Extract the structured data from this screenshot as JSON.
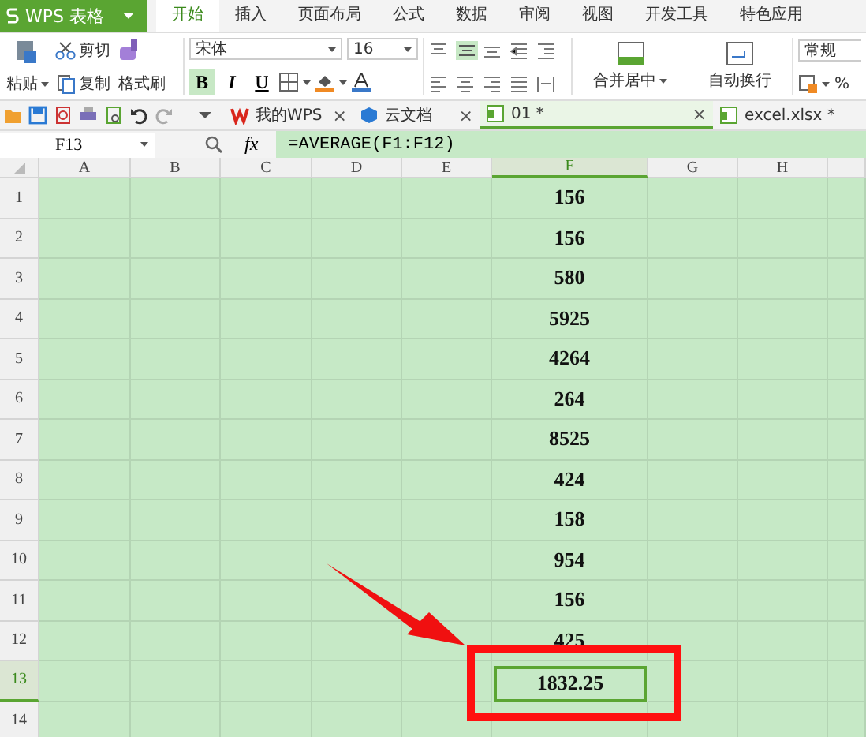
{
  "app": {
    "label": "WPS 表格"
  },
  "ribbon_tabs": [
    {
      "label": "开始",
      "selected": true
    },
    {
      "label": "插入",
      "selected": false
    },
    {
      "label": "页面布局",
      "selected": false
    },
    {
      "label": "公式",
      "selected": false
    },
    {
      "label": "数据",
      "selected": false
    },
    {
      "label": "审阅",
      "selected": false
    },
    {
      "label": "视图",
      "selected": false
    },
    {
      "label": "开发工具",
      "selected": false
    },
    {
      "label": "特色应用",
      "selected": false
    }
  ],
  "ribbon": {
    "paste": "粘贴",
    "cut": "剪切",
    "copy": "复制",
    "format_painter": "格式刷",
    "font_name": "宋体",
    "font_size": "16",
    "styles": [
      {
        "label": "B",
        "on": true
      },
      {
        "label": "I",
        "on": false
      },
      {
        "label": "U",
        "on": false
      }
    ],
    "merge": "合并居中",
    "wrap": "自动换行",
    "number_format": "常规",
    "percent": "%"
  },
  "doc_tabs": [
    {
      "label": "我的WPS",
      "selected": false,
      "close": "×"
    },
    {
      "label": "云文档",
      "selected": false,
      "close": "×"
    },
    {
      "label": "01 *",
      "selected": true,
      "close": "×"
    },
    {
      "label": "excel.xlsx *",
      "selected": false
    }
  ],
  "formula_bar": {
    "name_box": "F13",
    "fx": "fx",
    "formula": "=AVERAGE(F1:F12)"
  },
  "columns": [
    {
      "label": "A",
      "selected": false
    },
    {
      "label": "B",
      "selected": false
    },
    {
      "label": "C",
      "selected": false
    },
    {
      "label": "D",
      "selected": false
    },
    {
      "label": "E",
      "selected": false
    },
    {
      "label": "F",
      "selected": true
    },
    {
      "label": "G",
      "selected": false
    },
    {
      "label": "H",
      "selected": false
    }
  ],
  "rows": [
    {
      "number": "1",
      "f": "156",
      "selected": false
    },
    {
      "number": "2",
      "f": "156",
      "selected": false
    },
    {
      "number": "3",
      "f": "580",
      "selected": false
    },
    {
      "number": "4",
      "f": "5925",
      "selected": false
    },
    {
      "number": "5",
      "f": "4264",
      "selected": false
    },
    {
      "number": "6",
      "f": "264",
      "selected": false
    },
    {
      "number": "7",
      "f": "8525",
      "selected": false
    },
    {
      "number": "8",
      "f": "424",
      "selected": false
    },
    {
      "number": "9",
      "f": "158",
      "selected": false
    },
    {
      "number": "10",
      "f": "954",
      "selected": false
    },
    {
      "number": "11",
      "f": "156",
      "selected": false
    },
    {
      "number": "12",
      "f": "425",
      "selected": false
    },
    {
      "number": "13",
      "f": "1832.25",
      "selected": true
    },
    {
      "number": "14",
      "selected": false
    }
  ]
}
